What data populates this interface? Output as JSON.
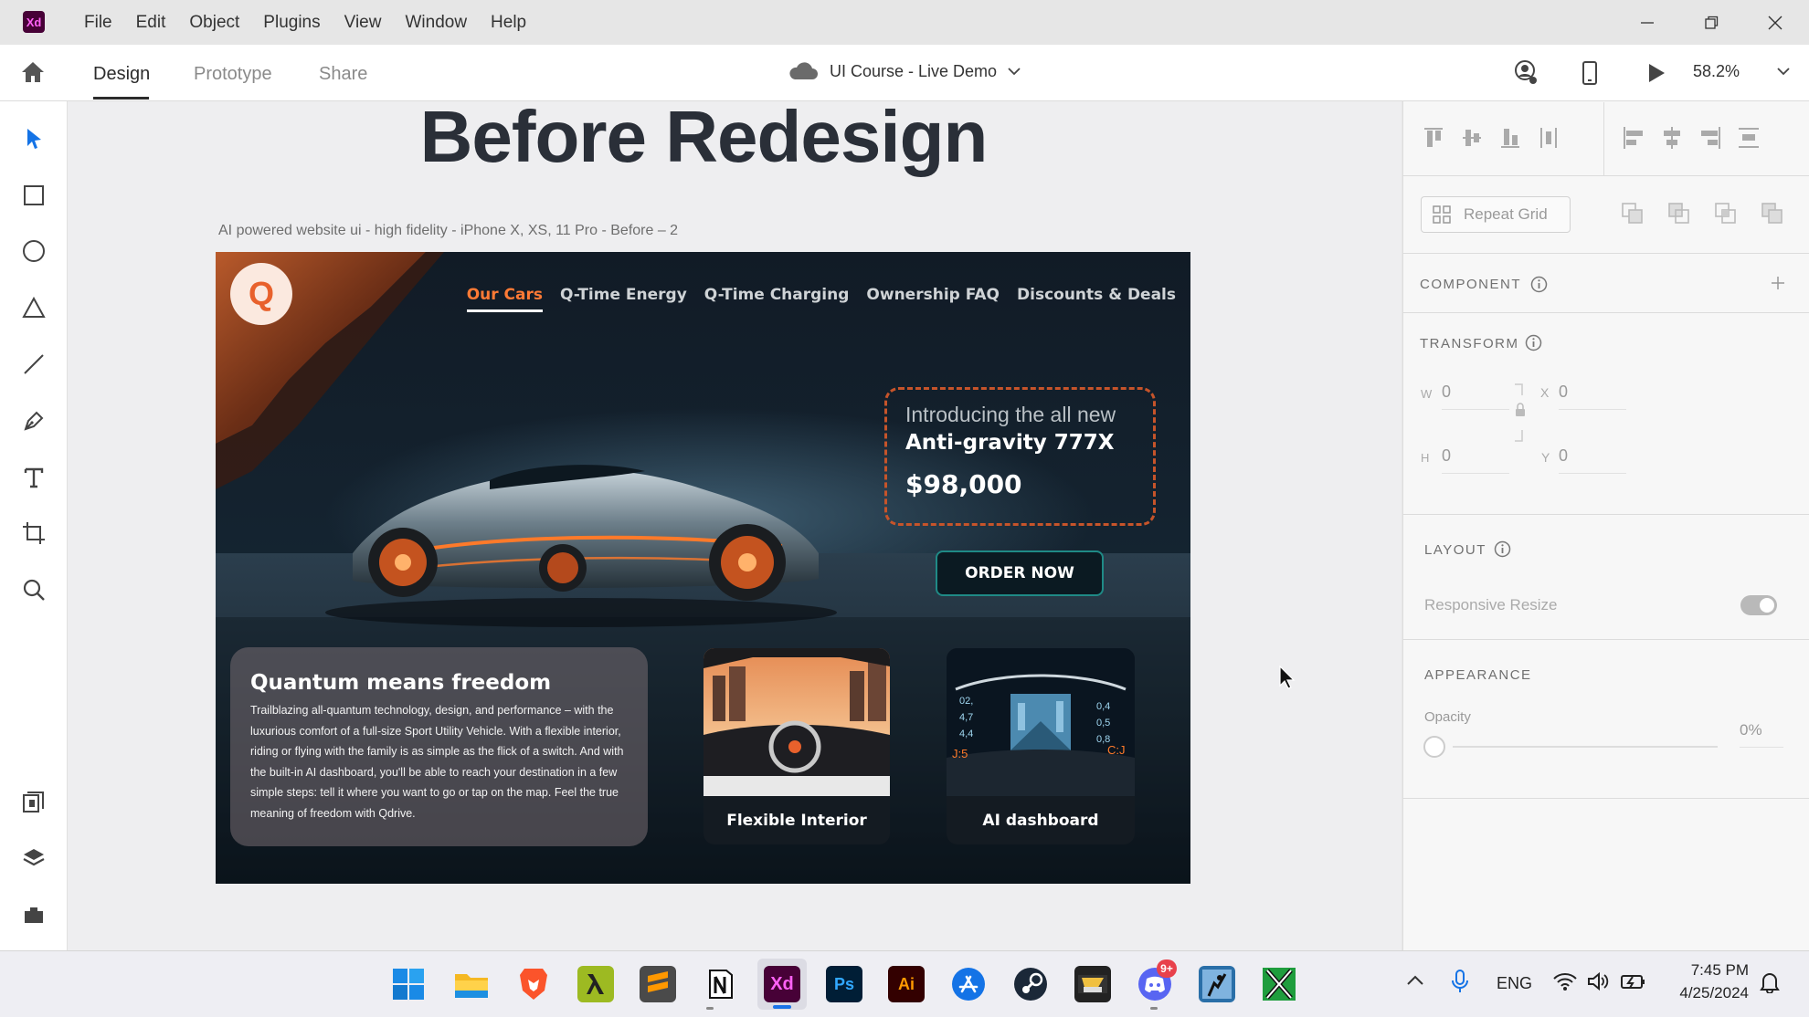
{
  "app": {
    "logo_text": "Xd",
    "menu": [
      "File",
      "Edit",
      "Object",
      "Plugins",
      "View",
      "Window",
      "Help"
    ]
  },
  "toolbar": {
    "tabs": [
      "Design",
      "Prototype",
      "Share"
    ],
    "active_tab": "Design",
    "document_title": "UI Course - Live Demo",
    "zoom": "58.2%"
  },
  "canvas": {
    "heading": "Before Redesign",
    "artboard_label": "AI powered website ui - high fidelity - iPhone X, XS, 11 Pro - Before – 2"
  },
  "site": {
    "logo_letter": "Q",
    "nav": [
      "Our Cars",
      "Q-Time Energy",
      "Q-Time Charging",
      "Ownership FAQ",
      "Discounts & Deals"
    ],
    "active_nav": "Our Cars",
    "promo": {
      "intro": "Introducing the all new",
      "model": "Anti-gravity 777X",
      "price": "$98,000"
    },
    "cta": "ORDER NOW",
    "info_card": {
      "title": "Quantum means freedom",
      "body": "Trailblazing all-quantum technology, design, and performance – with the luxurious comfort of a full-size Sport Utility Vehicle. With a flexible interior, riding or flying with the family is as simple as the flick of a switch. And with the built-in AI dashboard, you'll be able to reach your destination in a few simple steps: tell it where you want to go or tap on the map. Feel the true meaning of freedom with Qdrive."
    },
    "feature_cards": [
      {
        "label": "Flexible Interior"
      },
      {
        "label": "AI dashboard"
      }
    ],
    "dashboard_readouts": [
      "02,",
      "4,7",
      "0,4",
      "0,5",
      "4,4",
      "0,8",
      "J:5",
      "C:J"
    ],
    "accent": "#e8612c",
    "teal": "#1f8a86"
  },
  "panel": {
    "repeat_grid": "Repeat Grid",
    "component_title": "COMPONENT",
    "transform_title": "TRANSFORM",
    "w_label": "W",
    "w_value": "0",
    "x_label": "X",
    "x_value": "0",
    "h_label": "H",
    "h_value": "0",
    "y_label": "Y",
    "y_value": "0",
    "layout_title": "LAYOUT",
    "responsive_resize": "Responsive Resize",
    "responsive_resize_on": true,
    "appearance_title": "APPEARANCE",
    "opacity_label": "Opacity",
    "opacity_value": "0%"
  },
  "taskbar": {
    "apps": [
      "windows-start",
      "file-explorer",
      "brave",
      "lambda-app",
      "sublime-text",
      "notion",
      "adobe-xd",
      "photoshop",
      "illustrator",
      "app-store-blue",
      "steam",
      "media-app",
      "discord",
      "pen-tool-app",
      "excel-like"
    ],
    "discord_badge": "9+",
    "language": "ENG",
    "time": "7:45 PM",
    "date": "4/25/2024"
  }
}
